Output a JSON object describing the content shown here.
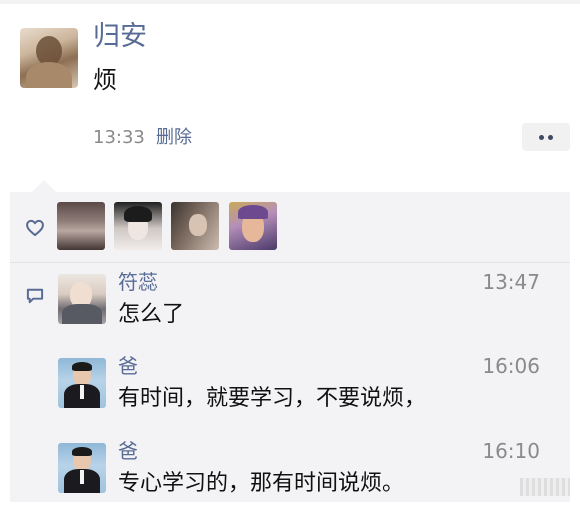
{
  "post": {
    "author_name": "归安",
    "text": "烦",
    "time": "13:33",
    "delete_label": "删除",
    "more_icon": "more-dots-icon"
  },
  "likes": {
    "icon": "heart-icon",
    "avatars": [
      "liker-avatar-1",
      "liker-avatar-2",
      "liker-avatar-3",
      "liker-avatar-4"
    ]
  },
  "comments": {
    "icon": "comment-icon",
    "items": [
      {
        "name": "符蕊",
        "time": "13:47",
        "text": "怎么了"
      },
      {
        "name": "爸",
        "time": "16:06",
        "text": "有时间，就要学习，不要说烦，"
      },
      {
        "name": "爸",
        "time": "16:10",
        "text": "专心学习的，那有时间说烦。"
      }
    ]
  },
  "colors": {
    "name_link": "#576b95",
    "meta_gray": "#8a8a8a",
    "panel_bg": "#f3f3f5"
  }
}
